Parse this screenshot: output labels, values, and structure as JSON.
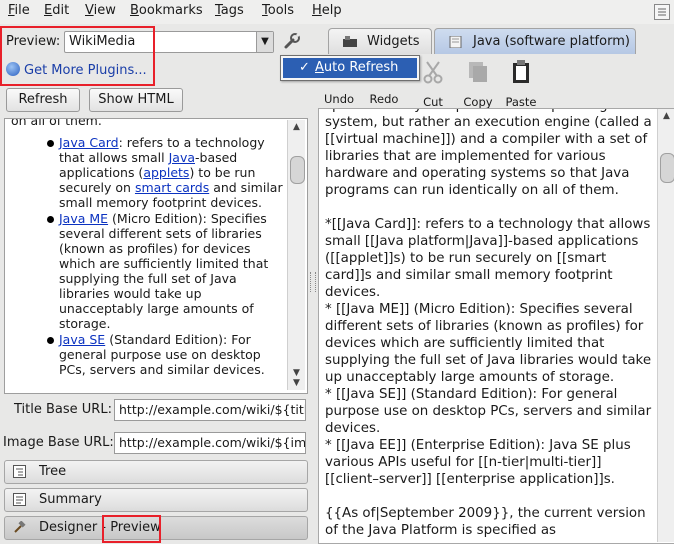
{
  "menubar": {
    "items": [
      "File",
      "Edit",
      "View",
      "Bookmarks",
      "Tags",
      "Tools",
      "Help"
    ],
    "mnemonics": [
      "F",
      "E",
      "V",
      "B",
      "T",
      "T",
      "H"
    ]
  },
  "preview": {
    "label": "Preview:",
    "selected": "WikiMedia",
    "get_plugins": "Get More Plugins...",
    "refresh_label": "Refresh",
    "show_html_label": "Show HTML"
  },
  "rendered": {
    "top_fragment": "on all of them.",
    "items": [
      {
        "link": "Java Card",
        "parts": [
          ": refers to a technology that allows small ",
          "-based applications (",
          ") to be run securely on ",
          " and similar small memory footprint devices."
        ],
        "links2": [
          "Java",
          "applets",
          "smart cards"
        ]
      },
      {
        "link": "Java ME",
        "text": " (Micro Edition): Specifies several different sets of libraries (known as profiles) for devices which are sufficiently limited that supplying the full set of Java libraries would take up unacceptably large amounts of storage."
      },
      {
        "link": "Java SE",
        "text": " (Standard Edition): For general purpose use on desktop PCs, servers and similar devices."
      }
    ]
  },
  "settings": {
    "title_base_label": "Title Base URL:",
    "title_base_value": "http://example.com/wiki/${titl",
    "image_base_label": "Image Base URL:",
    "image_base_value": "http://example.com/wiki/${ima"
  },
  "accordion": {
    "tree": "Tree",
    "summary": "Summary",
    "designer_prefix": "Designer - ",
    "designer_preview": "Preview"
  },
  "tabs": {
    "widgets": "Widgets",
    "java": "Java (software platform)"
  },
  "toolbar": {
    "undo": "Undo",
    "redo": "Redo",
    "cut": "Cut",
    "copy": "Copy",
    "paste": "Paste"
  },
  "popup": {
    "check": "✓",
    "label": "Auto Refresh"
  },
  "editor": {
    "paragraphs": [
      "specific to any one processor or operating system, but rather an execution engine (called a [[virtual machine]]) and a compiler with a set of libraries that are implemented for various hardware and operating systems so that Java programs can run identically on all of them.",
      "*[[Java Card]]: refers to a technology that allows small [[Java platform|Java]]-based applications ([[applet]]s) to be run securely on [[smart card]]s and similar small memory footprint devices.\n* [[Java ME]] (Micro Edition): Specifies several different sets of libraries (known as profiles) for devices which are sufficiently limited that supplying the full set of Java libraries would take up unacceptably large amounts of storage.\n* [[Java SE]] (Standard Edition): For general purpose use on desktop PCs, servers and similar devices.\n* [[Java EE]] (Enterprise Edition): Java SE plus various APIs useful for [[n-tier|multi-tier]] [[client–server]] [[enterprise application]]s.",
      "{{As of|September 2009}}, the current version of the Java Platform is specified as"
    ]
  },
  "colors": {
    "highlight": "#e8202a",
    "menu_selection": "#2c5fb3",
    "link": "#0b32c0"
  }
}
